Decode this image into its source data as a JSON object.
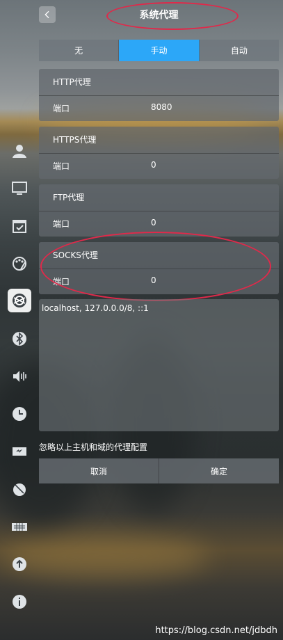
{
  "header": {
    "title": "系统代理",
    "back_icon": "chevron-left-icon"
  },
  "tabs": [
    {
      "label": "无",
      "active": false
    },
    {
      "label": "手动",
      "active": true
    },
    {
      "label": "自动",
      "active": false
    }
  ],
  "proxies": [
    {
      "name": "HTTP代理",
      "port_label": "端口",
      "port": "8080"
    },
    {
      "name": "HTTPS代理",
      "port_label": "端口",
      "port": "0"
    },
    {
      "name": "FTP代理",
      "port_label": "端口",
      "port": "0"
    },
    {
      "name": "SOCKS代理",
      "port_label": "端口",
      "port": "0"
    }
  ],
  "ignore_hosts": {
    "value": "localhost, 127.0.0.0/8, ::1"
  },
  "ignore_note": "忽略以上主机和域的代理配置",
  "buttons": {
    "cancel": "取消",
    "confirm": "确定"
  },
  "sidebar_icons": [
    "user-icon",
    "display-icon",
    "calendar-icon",
    "palette-icon",
    "network-icon",
    "bluetooth-icon",
    "sound-icon",
    "clock-icon",
    "power-icon",
    "mouse-icon",
    "keyboard-icon",
    "update-icon",
    "info-icon"
  ],
  "active_sidebar": "network-icon",
  "watermark": "https://blog.csdn.net/jdbdh",
  "colors": {
    "accent": "#2ca7f8",
    "annotation": "#e0294a"
  }
}
